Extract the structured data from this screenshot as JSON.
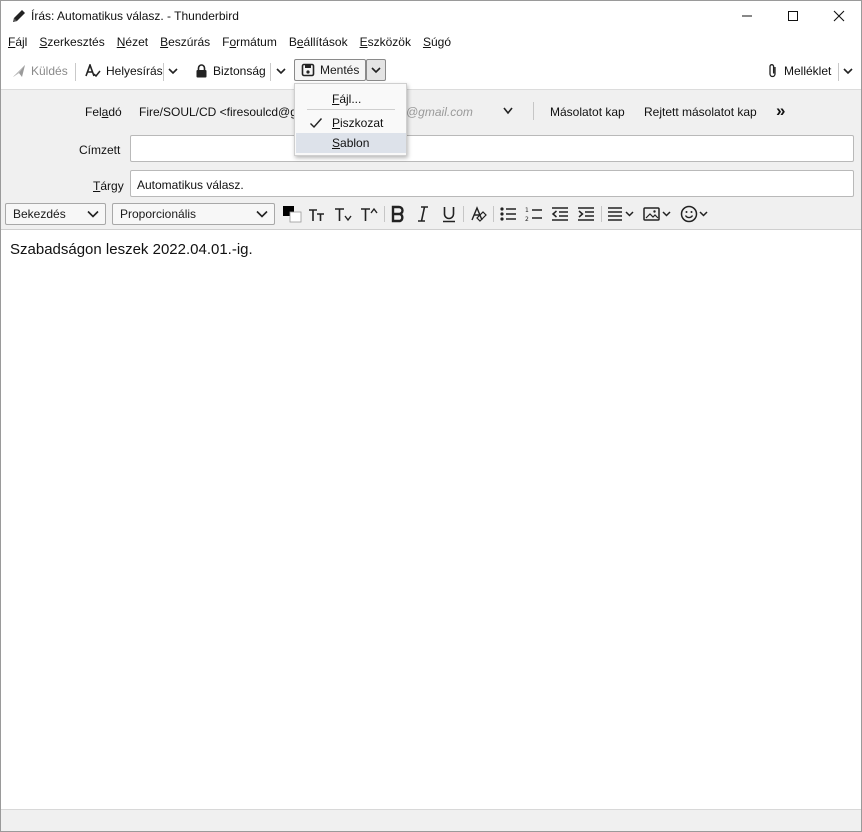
{
  "window": {
    "title": "Írás: Automatikus válasz. - Thunderbird"
  },
  "menu": [
    {
      "label": "Fájl",
      "ul": "F",
      "rest": "ájl"
    },
    {
      "label": "Szerkesztés",
      "ul": "S",
      "rest": "zerkesztés"
    },
    {
      "label": "Nézet",
      "ul": "N",
      "rest": "ézet"
    },
    {
      "label": "Beszúrás",
      "ul": "B",
      "rest": "eszúrás"
    },
    {
      "label": "Formátum",
      "pre": "F",
      "ul": "o",
      "rest": "rmátum"
    },
    {
      "label": "Beállítások",
      "pre": "B",
      "ul": "e",
      "rest": "állítások"
    },
    {
      "label": "Eszközök",
      "ul": "E",
      "rest": "szközök"
    },
    {
      "label": "Súgó",
      "ul": "S",
      "rest": "úgó"
    }
  ],
  "toolbar": {
    "send_label": "Küldés",
    "spelling_label": "Helyesírás",
    "security_label": "Biztonság",
    "save_label": "Mentés",
    "attachment_label": "Melléklet"
  },
  "save_menu": {
    "file": {
      "ul": "F",
      "rest": "ájl..."
    },
    "draft": {
      "ul": "P",
      "rest": "iszkozat"
    },
    "template": {
      "ul": "S",
      "rest": "ablon"
    }
  },
  "headers": {
    "from_label_pre": "Fel",
    "from_label_ul": "a",
    "from_label_post": "dó",
    "from_value": "Fire/SOUL/CD <firesoulcd@g",
    "from_ghost": "@gmail.com",
    "cc_link": "Másolatot kap",
    "bcc_link": "Rejtett másolatot kap",
    "more_icon_text": "»",
    "to_label": "Címzett",
    "to_value": "",
    "subject_label_ul": "T",
    "subject_label_rest": "árgy",
    "subject_value": "Automatikus válasz."
  },
  "format": {
    "paragraph_format": "Bekezdés",
    "font": "Proporcionális"
  },
  "editor": {
    "body": "Szabadságon leszek 2022.04.01.-ig."
  },
  "colors": {
    "header_bg": "#f0f0f0",
    "menu_hover": "#dde2ea",
    "ghost_text": "#9a9a9a"
  }
}
